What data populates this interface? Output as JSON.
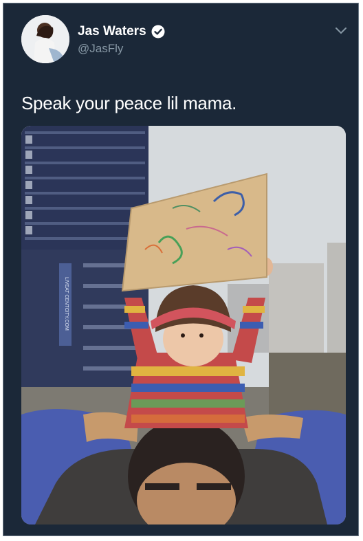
{
  "tweet": {
    "author": {
      "display_name": "Jas Waters",
      "handle": "@JasFly",
      "verified_icon": "verified-badge-icon",
      "avatar_icon": "avatar"
    },
    "menu_icon": "chevron-down-icon",
    "text": "Speak your peace lil mama.",
    "photo": {
      "building_sign": "LIVEAT CENTCITY.COM"
    }
  },
  "colors": {
    "background": "#1b2838",
    "text_primary": "#ffffff",
    "text_secondary": "#8899a6",
    "sign_cardboard": "#d8b98a"
  }
}
